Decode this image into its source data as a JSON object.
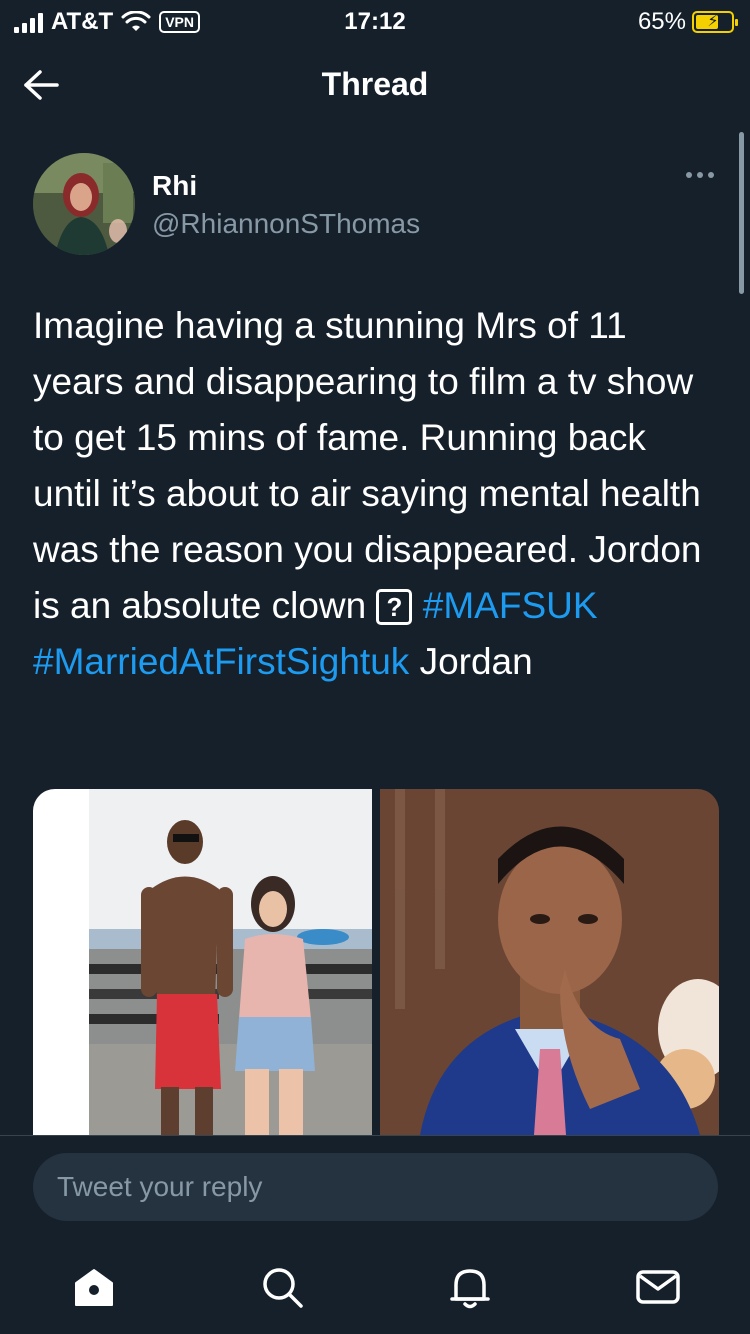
{
  "status_bar": {
    "carrier": "AT&T",
    "vpn_label": "VPN",
    "time": "17:12",
    "battery_percent": "65%",
    "battery_level": 0.65,
    "battery_color": "#f5d000"
  },
  "header": {
    "title": "Thread",
    "back_icon": "arrow-left-icon"
  },
  "tweet": {
    "author_name": "Rhi",
    "author_handle": "@RhiannonSThomas",
    "text": "Imagine having a stunning Mrs of 11 years and disappearing to film a tv show to get 15 mins of fame. Running back until it’s about to air saying mental health was the reason you disappeared. Jordon is an absolute clown ",
    "emoji_placeholder": "?",
    "hashtag_1": "#MAFSUK",
    "hashtag_2": "#MarriedAtFirstSightuk",
    "trailing_text": " Jordan",
    "link_color": "#1d9bf0",
    "media_count": 2
  },
  "reply": {
    "placeholder": "Tweet your reply"
  },
  "tab_bar": {
    "tabs": [
      "home-icon",
      "search-icon",
      "notifications-icon",
      "messages-icon"
    ]
  },
  "colors": {
    "background": "#15202b",
    "secondary_text": "#8899a6",
    "divider": "#38444d"
  }
}
